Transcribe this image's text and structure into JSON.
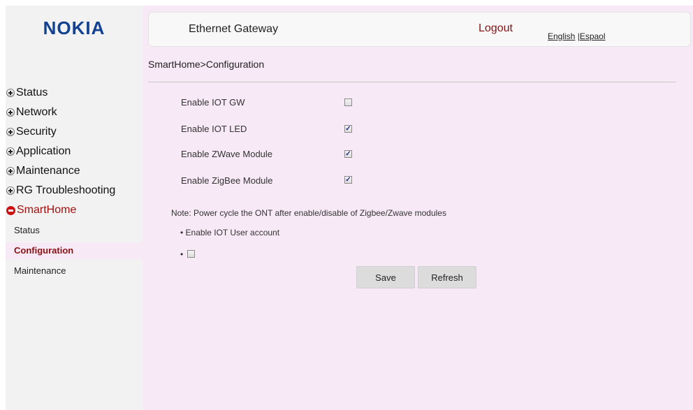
{
  "brand": {
    "logo_text": "NOKIA"
  },
  "header": {
    "title": "Ethernet Gateway",
    "logout_label": "Logout",
    "lang_english": "English",
    "lang_separator": "|",
    "lang_espanol": "Espaol"
  },
  "breadcrumb": "SmartHome>Configuration",
  "sidebar": {
    "items": [
      {
        "label": "Status",
        "icon": "plus-icon"
      },
      {
        "label": "Network",
        "icon": "plus-icon"
      },
      {
        "label": "Security",
        "icon": "plus-icon"
      },
      {
        "label": "Application",
        "icon": "plus-icon"
      },
      {
        "label": "Maintenance",
        "icon": "plus-icon"
      },
      {
        "label": "RG Troubleshooting",
        "icon": "plus-icon"
      },
      {
        "label": "SmartHome",
        "icon": "minus-icon",
        "expanded": true
      }
    ],
    "subitems": [
      {
        "label": "Status",
        "active": false
      },
      {
        "label": "Configuration",
        "active": true
      },
      {
        "label": "Maintenance",
        "active": false
      }
    ]
  },
  "form": {
    "rows": [
      {
        "label": "Enable IOT GW",
        "checked": false
      },
      {
        "label": "Enable IOT LED",
        "checked": true
      },
      {
        "label": "Enable ZWave Module",
        "checked": true
      },
      {
        "label": "Enable ZigBee Module",
        "checked": true
      }
    ],
    "note": "Note: Power cycle the ONT after enable/disable of Zigbee/Zwave modules",
    "user_account_label": "Enable IOT User account",
    "bullet_char": "•",
    "user_account_checked": false
  },
  "buttons": {
    "save": "Save",
    "refresh": "Refresh"
  },
  "colors": {
    "content_bg": "#f7e9f6",
    "sidebar_bg": "#f2f2f2",
    "accent_red": "#8b1111",
    "logo_blue": "#124191"
  }
}
